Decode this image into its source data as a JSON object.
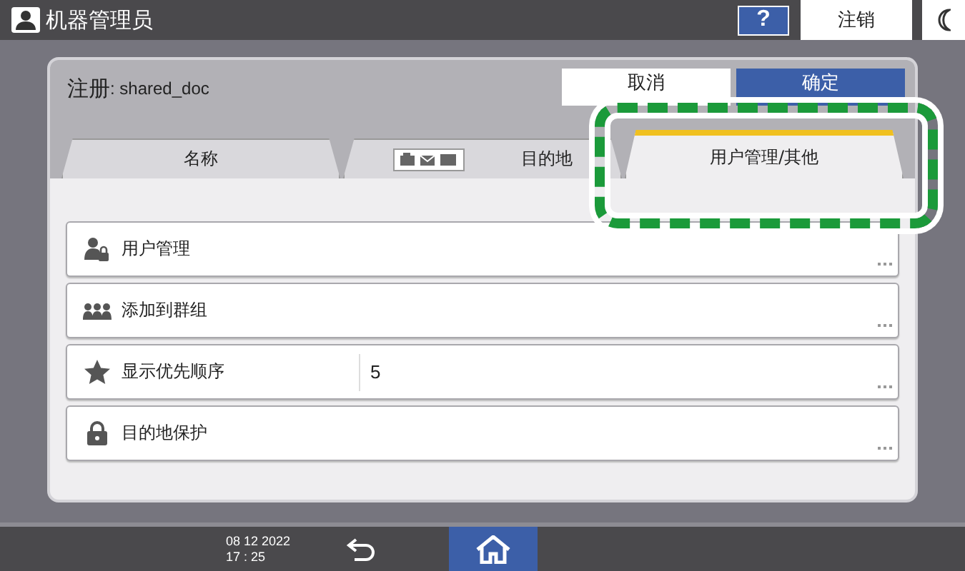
{
  "top_bar": {
    "title": "机器管理员",
    "help": "?",
    "logout": "注销"
  },
  "dialog": {
    "title": "注册",
    "subtitle": ": shared_doc",
    "buttons": [
      {
        "label": "取消",
        "kind": "cancel"
      },
      {
        "label": "确定",
        "kind": "ok"
      }
    ]
  },
  "tabs": [
    {
      "label": "名称",
      "selected": false,
      "kind": "plain"
    },
    {
      "label": "目的地",
      "selected": false,
      "kind": "icons"
    },
    {
      "label": "用户管理/其他",
      "selected": true,
      "kind": "plain"
    }
  ],
  "rows": [
    {
      "label": "用户管理",
      "kind": "user-lock"
    },
    {
      "label": "添加到群组",
      "kind": "group"
    },
    {
      "label": "显示优先顺序",
      "kind": "star",
      "value": "5"
    },
    {
      "label": "目的地保护",
      "kind": "lock"
    }
  ],
  "status_bar": {
    "date": "08 12 2022",
    "time": "17 : 25"
  }
}
